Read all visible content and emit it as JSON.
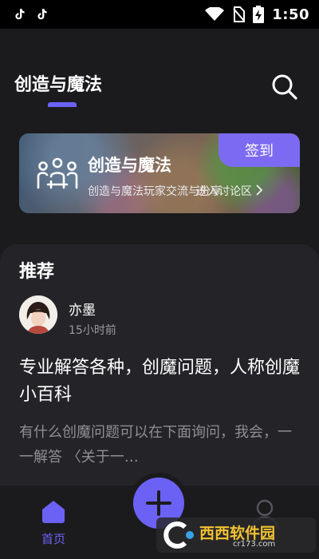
{
  "status_bar": {
    "time": "1:50"
  },
  "header": {
    "title": "创造与魔法"
  },
  "banner": {
    "title": "创造与魔法",
    "description": "创造与魔法玩家交流与分享",
    "enter_label": "进入讨论区",
    "checkin_label": "签到"
  },
  "feed": {
    "section_title": "推荐",
    "post": {
      "author": "亦墨",
      "time": "15小时前",
      "title": "专业解答各种，创魔问题，人称创魔小百科",
      "excerpt": "有什么创魔问题可以在下面询问，我会，一一解答 〈关于一…"
    }
  },
  "bottom_nav": {
    "home_label": "首页"
  },
  "watermark": {
    "text": "西西软件园",
    "url": "cr173.com"
  },
  "colors": {
    "accent": "#6b62f5",
    "checkin": "#7c6bf2",
    "background": "#1b1b1e",
    "card": "#242428"
  },
  "icons": [
    "tiktok-icon",
    "wifi-icon",
    "no-sim-icon",
    "battery-charging-icon",
    "search-icon",
    "group-icon",
    "chevron-right-icon",
    "home-icon",
    "plus-icon",
    "profile-icon"
  ]
}
